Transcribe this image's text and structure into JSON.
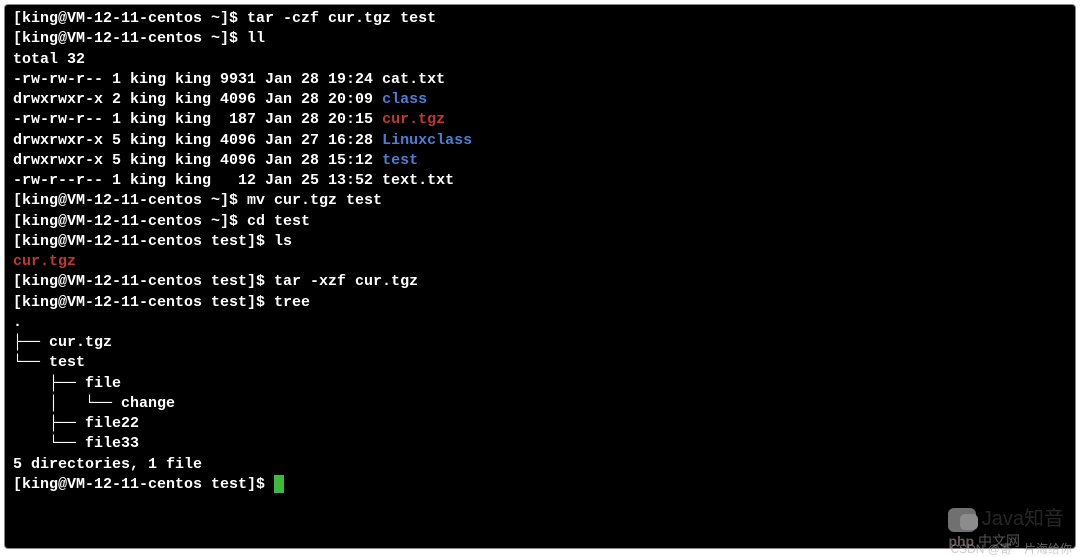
{
  "terminal": {
    "lines": [
      {
        "segments": [
          {
            "t": "[king@VM-12-11-centos ~]$ tar -czf cur.tgz test"
          }
        ]
      },
      {
        "segments": [
          {
            "t": "[king@VM-12-11-centos ~]$ ll"
          }
        ]
      },
      {
        "segments": [
          {
            "t": "total 32"
          }
        ]
      },
      {
        "segments": [
          {
            "t": "-rw-rw-r-- 1 king king 9931 Jan 28 19:24 cat.txt"
          }
        ]
      },
      {
        "segments": [
          {
            "t": "drwxrwxr-x 2 king king 4096 Jan 28 20:09 "
          },
          {
            "t": "class",
            "c": "dir-blue"
          }
        ]
      },
      {
        "segments": [
          {
            "t": "-rw-rw-r-- 1 king king  187 Jan 28 20:15 "
          },
          {
            "t": "cur.tgz",
            "c": "file-red"
          }
        ]
      },
      {
        "segments": [
          {
            "t": "drwxrwxr-x 5 king king 4096 Jan 27 16:28 "
          },
          {
            "t": "Linuxclass",
            "c": "dir-blue"
          }
        ]
      },
      {
        "segments": [
          {
            "t": "drwxrwxr-x 5 king king 4096 Jan 28 15:12 "
          },
          {
            "t": "test",
            "c": "dir-blue"
          }
        ]
      },
      {
        "segments": [
          {
            "t": "-rw-r--r-- 1 king king   12 Jan 25 13:52 text.txt"
          }
        ]
      },
      {
        "segments": [
          {
            "t": "[king@VM-12-11-centos ~]$ mv cur.tgz test"
          }
        ]
      },
      {
        "segments": [
          {
            "t": "[king@VM-12-11-centos ~]$ cd test"
          }
        ]
      },
      {
        "segments": [
          {
            "t": "[king@VM-12-11-centos test]$ ls"
          }
        ]
      },
      {
        "segments": [
          {
            "t": "cur.tgz",
            "c": "file-red"
          }
        ]
      },
      {
        "segments": [
          {
            "t": "[king@VM-12-11-centos test]$ tar -xzf cur.tgz"
          }
        ]
      },
      {
        "segments": [
          {
            "t": "[king@VM-12-11-centos test]$ tree"
          }
        ]
      },
      {
        "segments": [
          {
            "t": "."
          }
        ]
      },
      {
        "segments": [
          {
            "t": "├── cur.tgz"
          }
        ]
      },
      {
        "segments": [
          {
            "t": "└── test"
          }
        ]
      },
      {
        "segments": [
          {
            "t": "    ├── file"
          }
        ]
      },
      {
        "segments": [
          {
            "t": "    │   └── change"
          }
        ]
      },
      {
        "segments": [
          {
            "t": "    ├── file22"
          }
        ]
      },
      {
        "segments": [
          {
            "t": "    └── file33"
          }
        ]
      },
      {
        "segments": [
          {
            "t": ""
          }
        ]
      },
      {
        "segments": [
          {
            "t": "5 directories, 1 file"
          }
        ]
      },
      {
        "segments": [
          {
            "t": "[king@VM-12-11-centos test]$ "
          }
        ],
        "cursor": true
      }
    ]
  },
  "watermarks": {
    "java": "Java知音",
    "php": "php",
    "cn": "中文网",
    "csdn": "CSDN @寄一片海给你"
  }
}
